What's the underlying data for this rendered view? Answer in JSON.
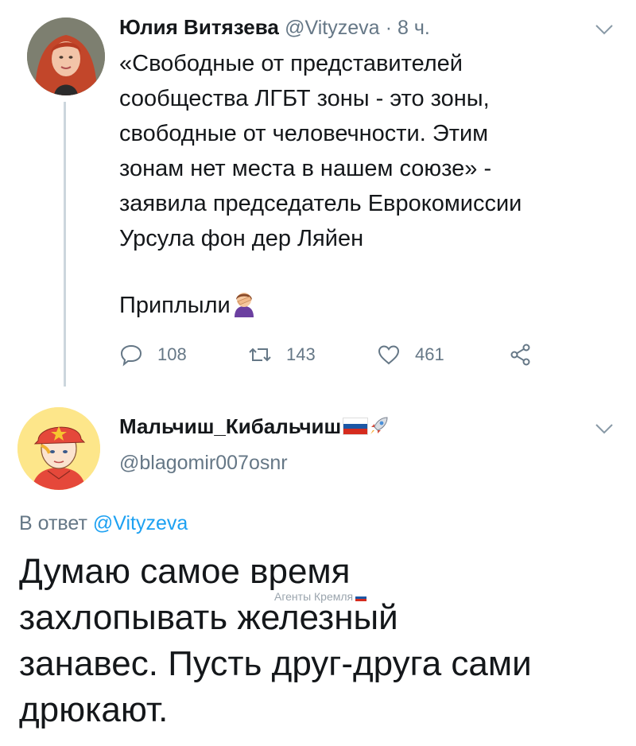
{
  "tweet1": {
    "author_name": "Юлия Витязева",
    "handle": "@Vityzeva",
    "time": "· 8 ч.",
    "lines": [
      "«Свободные от представителей",
      "сообщества ЛГБТ зоны - это зоны,",
      "свободные от человечности. Этим",
      "зонам нет места в нашем союзе» -",
      "заявила председатель Еврокомиссии",
      "Урсула фон дер Ляйен"
    ],
    "extra_line": "Приплыли",
    "reply_count": "108",
    "retweet_count": "143",
    "like_count": "461"
  },
  "tweet2": {
    "author_name": "Мальчиш_Кибальчиш",
    "handle": "@blagomir007osnr",
    "reply_prefix": "В ответ",
    "reply_mention": "@Vityzeva",
    "lines": [
      "Думаю самое время",
      "захлопывать железный",
      "занавес. Пусть друг-друга сами",
      "дрюкают."
    ]
  },
  "watermark": "Агенты Кремля",
  "colors": {
    "text": "#14171a",
    "secondary": "#657786",
    "accent": "#1da1f2",
    "thread_line": "#ccd6dd"
  },
  "icons": {
    "reply": "reply-icon",
    "retweet": "retweet-icon",
    "like": "heart-icon",
    "share": "share-icon",
    "more": "chevron-down-icon",
    "flag": "russian-flag-icon",
    "rocket": "rocket-icon",
    "facepalm": "facepalm-emoji-icon"
  }
}
